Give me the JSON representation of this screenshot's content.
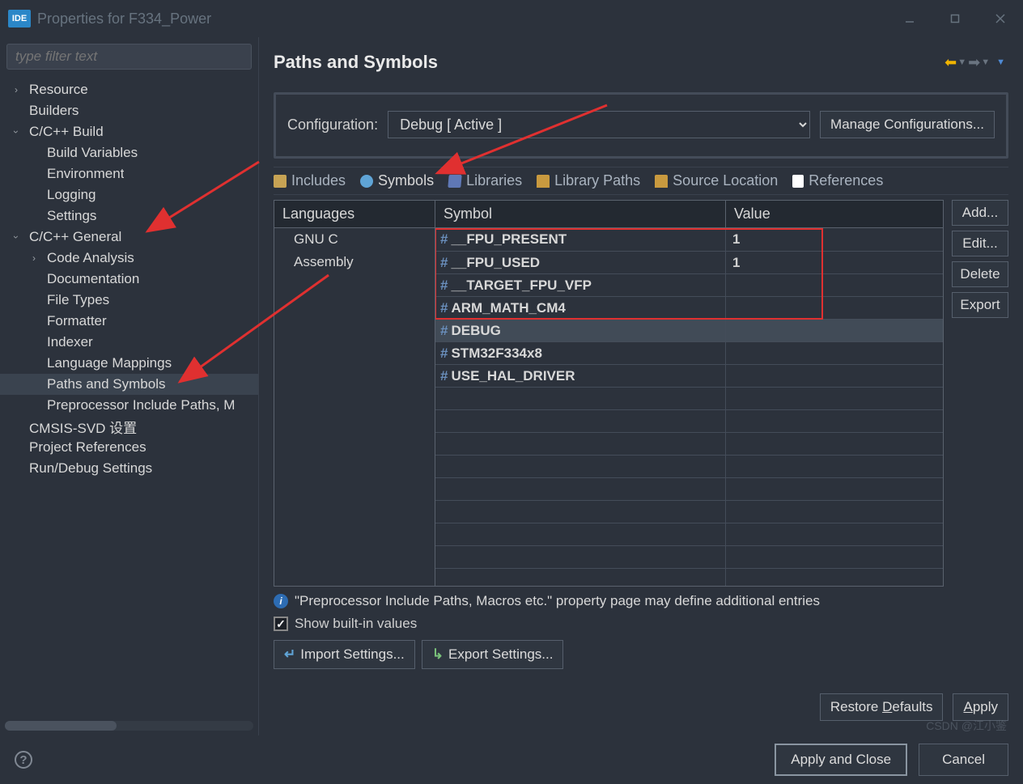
{
  "window": {
    "logo": "IDE",
    "title": "Properties for F334_Power"
  },
  "filter_placeholder": "type filter text",
  "tree": {
    "resource": "Resource",
    "builders": "Builders",
    "ccpp_build": "C/C++ Build",
    "build_vars": "Build Variables",
    "environment": "Environment",
    "logging": "Logging",
    "settings": "Settings",
    "ccpp_general": "C/C++ General",
    "code_analysis": "Code Analysis",
    "documentation": "Documentation",
    "file_types": "File Types",
    "formatter": "Formatter",
    "indexer": "Indexer",
    "lang_mappings": "Language Mappings",
    "paths_symbols": "Paths and Symbols",
    "preprocessor": "Preprocessor Include Paths, M",
    "cmsis_svd": "CMSIS-SVD 设置",
    "project_refs": "Project References",
    "rundebug": "Run/Debug Settings"
  },
  "header": {
    "title": "Paths and Symbols"
  },
  "config": {
    "label": "Configuration:",
    "value": "Debug  [ Active ]",
    "manage": "Manage Configurations..."
  },
  "tabs": {
    "includes": "Includes",
    "symbols": "Symbols",
    "libraries": "Libraries",
    "library_paths": "Library Paths",
    "source_location": "Source Location",
    "references": "References"
  },
  "columns": {
    "languages": "Languages",
    "symbol": "Symbol",
    "value": "Value"
  },
  "languages": {
    "gnu_c": "GNU C",
    "assembly": "Assembly"
  },
  "symbols": [
    {
      "name": "__FPU_PRESENT",
      "value": "1"
    },
    {
      "name": "__FPU_USED",
      "value": "1"
    },
    {
      "name": "__TARGET_FPU_VFP",
      "value": ""
    },
    {
      "name": "ARM_MATH_CM4",
      "value": ""
    },
    {
      "name": "DEBUG",
      "value": ""
    },
    {
      "name": "STM32F334x8",
      "value": ""
    },
    {
      "name": "USE_HAL_DRIVER",
      "value": ""
    }
  ],
  "side_buttons": {
    "add": "Add...",
    "edit": "Edit...",
    "delete": "Delete",
    "export": "Export"
  },
  "info": "\"Preprocessor Include Paths, Macros etc.\" property page may define additional entries",
  "show_builtin": "Show built-in values",
  "import_settings": "Import Settings...",
  "export_settings": "Export Settings...",
  "restore_defaults": "Restore Defaults",
  "apply": "Apply",
  "apply_close": "Apply and Close",
  "cancel": "Cancel",
  "watermark": "CSDN @江小鉴"
}
